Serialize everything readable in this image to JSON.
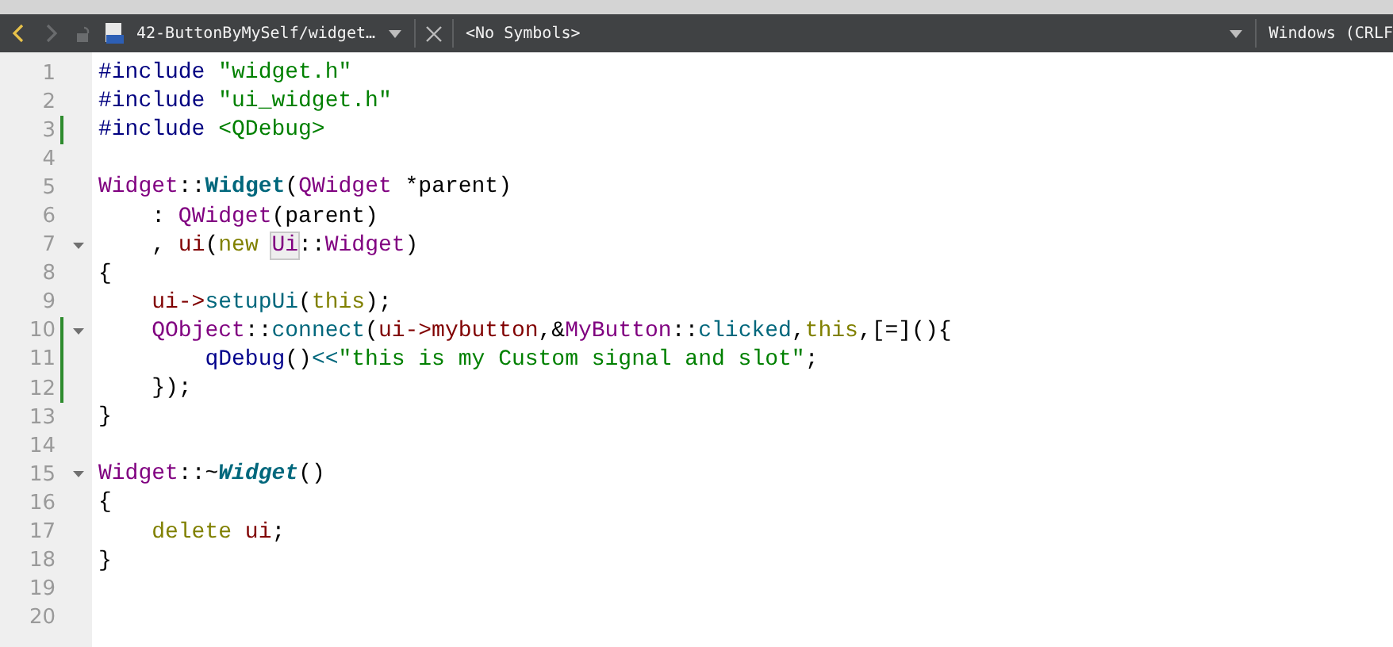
{
  "toolbar": {
    "back_enabled": true,
    "forward_enabled": false,
    "file_name": "42-ButtonByMySelf/widget…",
    "symbols": "<No Symbols>",
    "line_ending": "Windows (CRLF"
  },
  "lines": [
    {
      "number": "1",
      "changed": false,
      "foldable": false,
      "tokens": [
        {
          "kind": "preproc",
          "text": "#include "
        },
        {
          "kind": "string",
          "text": "\"widget.h\""
        }
      ]
    },
    {
      "number": "2",
      "changed": false,
      "foldable": false,
      "tokens": [
        {
          "kind": "preproc",
          "text": "#include "
        },
        {
          "kind": "string",
          "text": "\"ui_widget.h\""
        }
      ]
    },
    {
      "number": "3",
      "changed": true,
      "foldable": false,
      "tokens": [
        {
          "kind": "preproc",
          "text": "#include "
        },
        {
          "kind": "string",
          "text": "<QDebug>"
        }
      ]
    },
    {
      "number": "4",
      "changed": false,
      "foldable": false
    },
    {
      "number": "5",
      "changed": false,
      "foldable": false,
      "tokens": [
        {
          "kind": "type",
          "text": "Widget"
        },
        {
          "kind": "plain",
          "text": "::"
        },
        {
          "kind": "decl",
          "text": "Widget"
        },
        {
          "kind": "plain",
          "text": "("
        },
        {
          "kind": "type",
          "text": "QWidget"
        },
        {
          "kind": "plain",
          "text": " *parent)"
        }
      ]
    },
    {
      "number": "6",
      "changed": false,
      "foldable": false,
      "tokens": [
        {
          "kind": "plain",
          "text": "    : "
        },
        {
          "kind": "type",
          "text": "QWidget"
        },
        {
          "kind": "plain",
          "text": "(parent)"
        }
      ]
    },
    {
      "number": "7",
      "changed": false,
      "foldable": true,
      "tokens": [
        {
          "kind": "plain",
          "text": "    , "
        },
        {
          "kind": "member",
          "text": "ui"
        },
        {
          "kind": "plain",
          "text": "("
        },
        {
          "kind": "keyword",
          "text": "new "
        },
        {
          "kind": "match",
          "text": "Ui"
        },
        {
          "kind": "plain",
          "text": "::"
        },
        {
          "kind": "type",
          "text": "Widget"
        },
        {
          "kind": "plain",
          "text": ")"
        }
      ]
    },
    {
      "number": "8",
      "changed": false,
      "foldable": false,
      "tokens": [
        {
          "kind": "plain",
          "text": "{"
        }
      ]
    },
    {
      "number": "9",
      "changed": false,
      "foldable": false,
      "tokens": [
        {
          "kind": "member",
          "text": "    ui->"
        },
        {
          "kind": "func",
          "text": "setupUi"
        },
        {
          "kind": "plain",
          "text": "("
        },
        {
          "kind": "keyword",
          "text": "this"
        },
        {
          "kind": "plain",
          "text": ");"
        }
      ]
    },
    {
      "number": "10",
      "changed": true,
      "foldable": true,
      "tokens": [
        {
          "kind": "type",
          "text": "    QObject"
        },
        {
          "kind": "plain",
          "text": "::"
        },
        {
          "kind": "func",
          "text": "connect"
        },
        {
          "kind": "plain",
          "text": "("
        },
        {
          "kind": "member",
          "text": "ui->mybutton"
        },
        {
          "kind": "plain",
          "text": ",&"
        },
        {
          "kind": "type",
          "text": "MyButton"
        },
        {
          "kind": "plain",
          "text": "::"
        },
        {
          "kind": "func",
          "text": "clicked"
        },
        {
          "kind": "plain",
          "text": ","
        },
        {
          "kind": "keyword",
          "text": "this"
        },
        {
          "kind": "plain",
          "text": ",[=](){"
        }
      ]
    },
    {
      "number": "11",
      "changed": true,
      "foldable": false,
      "tokens": [
        {
          "kind": "call",
          "text": "        qDebug"
        },
        {
          "kind": "plain",
          "text": "()"
        },
        {
          "kind": "func",
          "text": "<<"
        },
        {
          "kind": "string",
          "text": "\"this is my Custom signal and slot\""
        },
        {
          "kind": "plain",
          "text": ";"
        }
      ]
    },
    {
      "number": "12",
      "changed": true,
      "foldable": false,
      "tokens": [
        {
          "kind": "plain",
          "text": "    });"
        }
      ]
    },
    {
      "number": "13",
      "changed": false,
      "foldable": false,
      "tokens": [
        {
          "kind": "plain",
          "text": "}"
        }
      ]
    },
    {
      "number": "14",
      "changed": false,
      "foldable": false
    },
    {
      "number": "15",
      "changed": false,
      "foldable": true,
      "tokens": [
        {
          "kind": "type",
          "text": "Widget"
        },
        {
          "kind": "plain",
          "text": "::~"
        },
        {
          "kind": "dtor",
          "text": "Widget"
        },
        {
          "kind": "plain",
          "text": "()"
        }
      ]
    },
    {
      "number": "16",
      "changed": false,
      "foldable": false,
      "tokens": [
        {
          "kind": "plain",
          "text": "{"
        }
      ]
    },
    {
      "number": "17",
      "changed": false,
      "foldable": false,
      "tokens": [
        {
          "kind": "keyword",
          "text": "    delete "
        },
        {
          "kind": "member",
          "text": "ui"
        },
        {
          "kind": "plain",
          "text": ";"
        }
      ]
    },
    {
      "number": "18",
      "changed": false,
      "foldable": false,
      "tokens": [
        {
          "kind": "plain",
          "text": "}"
        }
      ]
    },
    {
      "number": "19",
      "changed": false,
      "foldable": false
    },
    {
      "number": "20",
      "changed": false,
      "foldable": false
    }
  ]
}
